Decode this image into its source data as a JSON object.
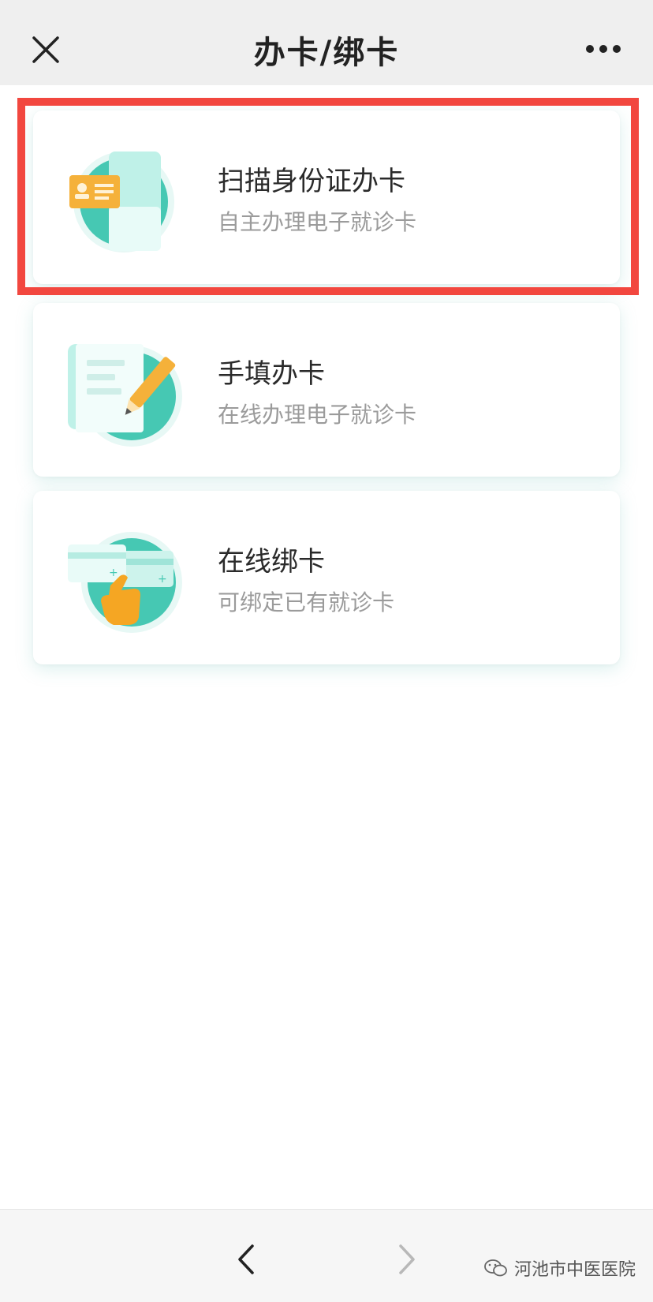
{
  "header": {
    "title": "办卡/绑卡"
  },
  "cards": [
    {
      "title": "扫描身份证办卡",
      "subtitle": "自主办理电子就诊卡",
      "icon": "id-card-scan-icon"
    },
    {
      "title": "手填办卡",
      "subtitle": "在线办理电子就诊卡",
      "icon": "form-edit-icon"
    },
    {
      "title": "在线绑卡",
      "subtitle": "可绑定已有就诊卡",
      "icon": "card-bind-icon"
    }
  ],
  "colors": {
    "accent": "#3fc6b0",
    "highlight": "#f2473f",
    "card_gold": "#f5b13a"
  },
  "footer": {
    "watermark": "河池市中医医院"
  }
}
